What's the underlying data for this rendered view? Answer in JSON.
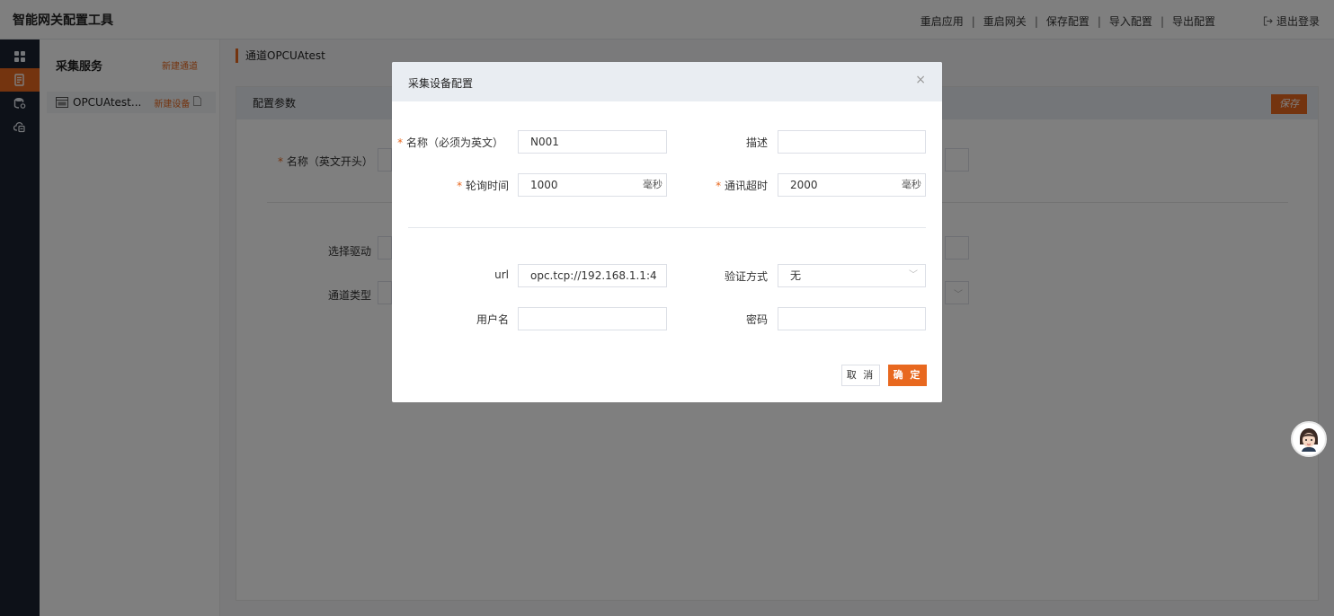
{
  "app": {
    "title": "智能网关配置工具"
  },
  "topnav": {
    "items": [
      "重启应用",
      "重启网关",
      "保存配置",
      "导入配置",
      "导出配置"
    ],
    "separator": "|",
    "logout": "退出登录"
  },
  "rail": {
    "items": [
      {
        "icon": "dashboard-icon",
        "active": false
      },
      {
        "icon": "collect-list-icon",
        "active": true
      },
      {
        "icon": "database-settings-icon",
        "active": false
      },
      {
        "icon": "cloud-upload-icon",
        "active": false
      }
    ]
  },
  "sidebar": {
    "title": "采集服务",
    "new_channel": "新建通道",
    "channel": {
      "name": "OPCUAtest...",
      "new_device": "新建设备"
    }
  },
  "main": {
    "breadcrumb": "通道OPCUAtest",
    "panel_title": "配置参数",
    "save": "保存",
    "fields": {
      "name_label": "名称（英文开头）",
      "driver_label": "选择驱动",
      "channel_type_label": "通道类型"
    }
  },
  "modal": {
    "title": "采集设备配置",
    "close": "×",
    "fields": {
      "name": {
        "label": "名称（必须为英文）",
        "value": "N001",
        "required": true
      },
      "desc": {
        "label": "描述",
        "value": ""
      },
      "poll": {
        "label": "轮询时间",
        "value": "1000",
        "unit": "毫秒",
        "required": true
      },
      "timeout": {
        "label": "通讯超时",
        "value": "2000",
        "unit": "毫秒",
        "required": true
      },
      "url": {
        "label": "url",
        "value": "opc.tcp://192.168.1.1:4"
      },
      "auth": {
        "label": "验证方式",
        "value": "无"
      },
      "username": {
        "label": "用户名",
        "value": ""
      },
      "password": {
        "label": "密码",
        "value": ""
      }
    },
    "cancel": "取 消",
    "confirm": "确 定"
  },
  "colors": {
    "accent": "#e8681f",
    "rail_bg": "#1b2230",
    "header_bg": "#e9edf2"
  }
}
